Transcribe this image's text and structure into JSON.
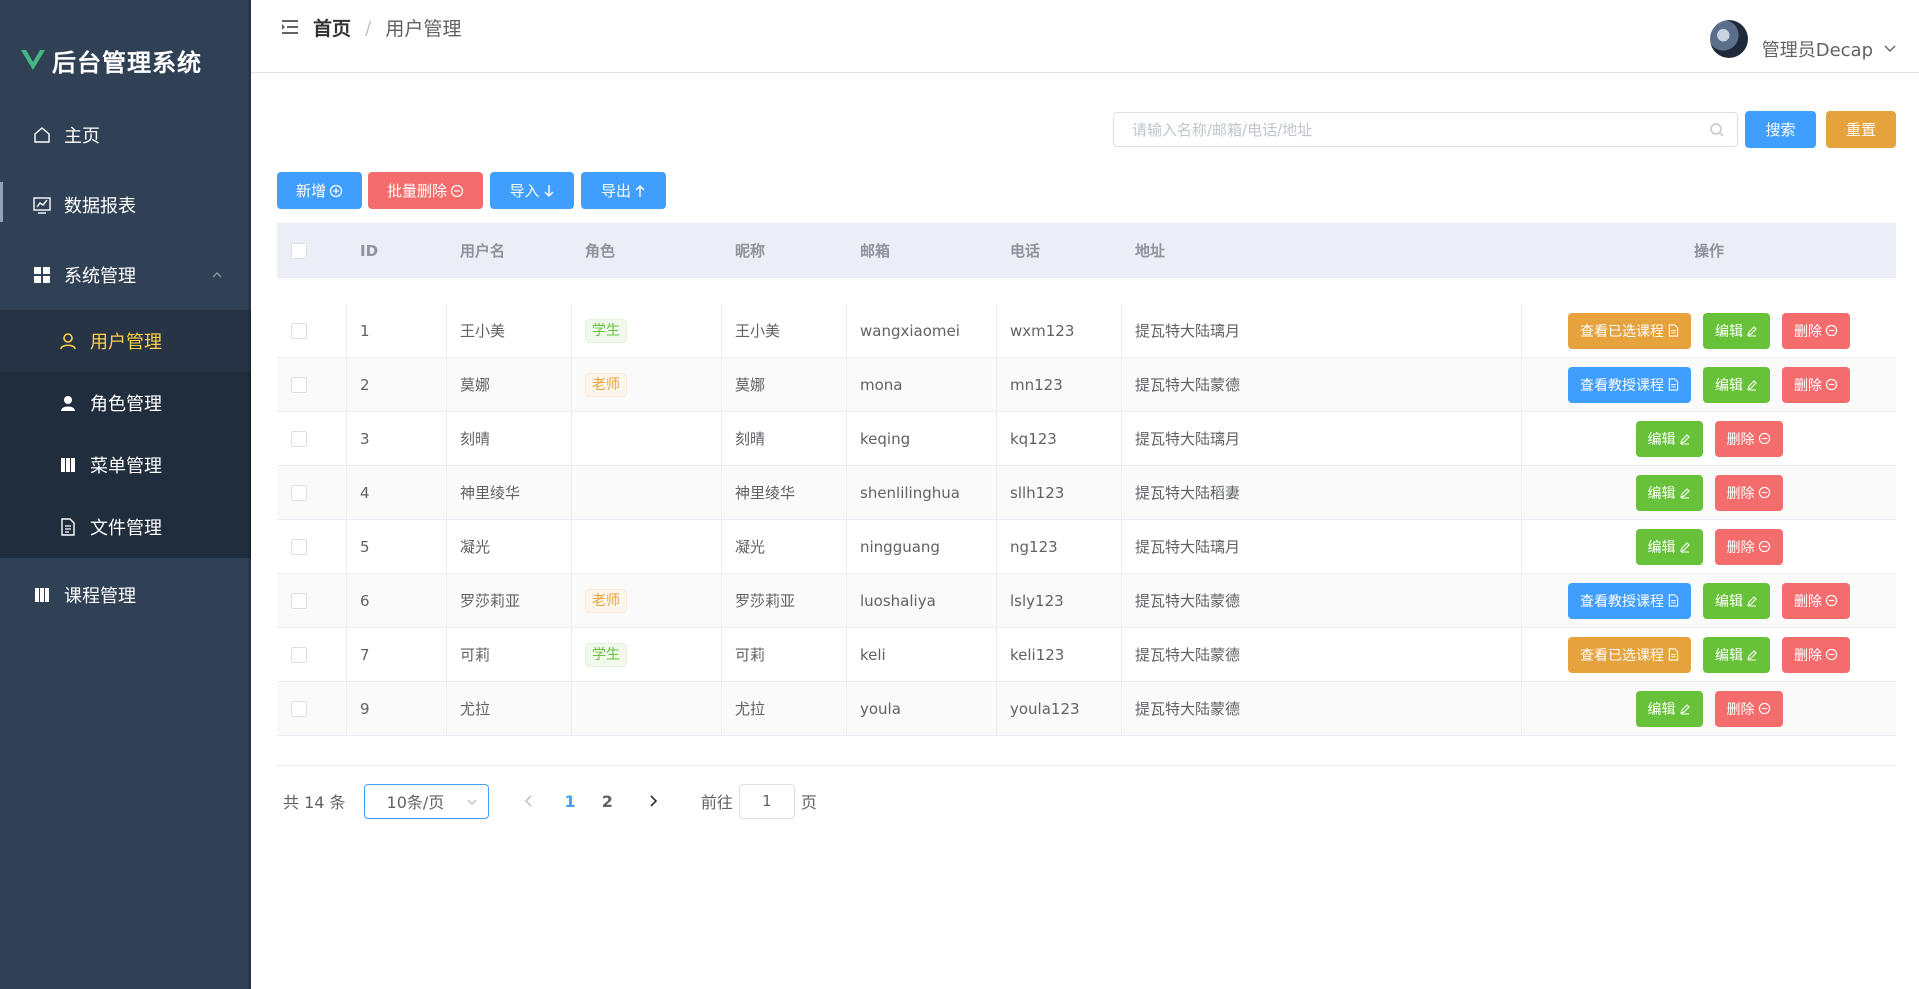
{
  "app": {
    "title": "后台管理系统",
    "brand_color": "#42b883"
  },
  "sidebar": {
    "items": [
      {
        "label": "主页",
        "icon": "home-icon"
      },
      {
        "label": "数据报表",
        "icon": "chart-icon"
      },
      {
        "label": "系统管理",
        "icon": "grid-icon",
        "expanded": true
      },
      {
        "label": "课程管理",
        "icon": "book-icon"
      }
    ],
    "subitems": [
      {
        "label": "用户管理",
        "icon": "user-icon",
        "active": true
      },
      {
        "label": "角色管理",
        "icon": "user-filled-icon"
      },
      {
        "label": "菜单管理",
        "icon": "book-icon"
      },
      {
        "label": "文件管理",
        "icon": "document-icon"
      }
    ]
  },
  "header": {
    "breadcrumb_home": "首页",
    "breadcrumb_sep": "/",
    "breadcrumb_current": "用户管理",
    "user_name": "管理员Decap"
  },
  "search": {
    "placeholder": "请输入名称/邮箱/电话/地址",
    "value": "",
    "search_label": "搜索",
    "reset_label": "重置"
  },
  "toolbar": {
    "add_label": "新增",
    "batch_delete_label": "批量删除",
    "import_label": "导入",
    "export_label": "导出"
  },
  "table": {
    "columns": [
      "ID",
      "用户名",
      "角色",
      "昵称",
      "邮箱",
      "电话",
      "地址",
      "操作"
    ],
    "rows": [
      {
        "id": "1",
        "username": "王小美",
        "role": "学生",
        "nickname": "王小美",
        "email": "wangxiaomei",
        "phone": "wxm123",
        "address": "提瓦特大陆璃月",
        "extra": "查看已选课程"
      },
      {
        "id": "2",
        "username": "莫娜",
        "role": "老师",
        "nickname": "莫娜",
        "email": "mona",
        "phone": "mn123",
        "address": "提瓦特大陆蒙德",
        "extra": "查看教授课程"
      },
      {
        "id": "3",
        "username": "刻晴",
        "role": "",
        "nickname": "刻晴",
        "email": "keqing",
        "phone": "kq123",
        "address": "提瓦特大陆璃月",
        "extra": ""
      },
      {
        "id": "4",
        "username": "神里绫华",
        "role": "",
        "nickname": "神里绫华",
        "email": "shenlilinghua",
        "phone": "sllh123",
        "address": "提瓦特大陆稻妻",
        "extra": ""
      },
      {
        "id": "5",
        "username": "凝光",
        "role": "",
        "nickname": "凝光",
        "email": "ningguang",
        "phone": "ng123",
        "address": "提瓦特大陆璃月",
        "extra": ""
      },
      {
        "id": "6",
        "username": "罗莎莉亚",
        "role": "老师",
        "nickname": "罗莎莉亚",
        "email": "luoshaliya",
        "phone": "lsly123",
        "address": "提瓦特大陆蒙德",
        "extra": "查看教授课程"
      },
      {
        "id": "7",
        "username": "可莉",
        "role": "学生",
        "nickname": "可莉",
        "email": "keli",
        "phone": "keli123",
        "address": "提瓦特大陆蒙德",
        "extra": "查看已选课程"
      },
      {
        "id": "9",
        "username": "尤拉",
        "role": "",
        "nickname": "尤拉",
        "email": "youla",
        "phone": "youla123",
        "address": "提瓦特大陆蒙德",
        "extra": ""
      }
    ],
    "edit_label": "编辑",
    "delete_label": "删除"
  },
  "pagination": {
    "total_text": "共 14 条",
    "page_size": "10条/页",
    "pages": [
      "1",
      "2"
    ],
    "current_page": "1",
    "goto_prefix": "前往",
    "goto_value": "1",
    "goto_suffix": "页"
  }
}
